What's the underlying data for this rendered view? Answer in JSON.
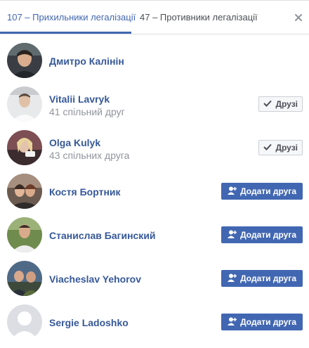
{
  "tabs": [
    {
      "label": "107 – Прихильники легалізації",
      "active": true
    },
    {
      "label": "47 – Противники легалізації",
      "active": false
    }
  ],
  "people": [
    {
      "name": "Дмитро Калінін",
      "mutual": "",
      "action": "none",
      "avatar": "photo-man-dark-hair"
    },
    {
      "name": "Vitalii Lavryk",
      "mutual": "41 спільний друг",
      "action": "friends",
      "avatar": "photo-man-white-shirt"
    },
    {
      "name": "Olga Kulyk",
      "mutual": "43 спільних друга",
      "action": "friends",
      "avatar": "photo-woman-blonde"
    },
    {
      "name": "Костя Бортник",
      "mutual": "",
      "action": "add",
      "avatar": "photo-couple"
    },
    {
      "name": "Станислав Багинский",
      "mutual": "",
      "action": "add",
      "avatar": "photo-man-outdoors"
    },
    {
      "name": "Viacheslav Yehorov",
      "mutual": "",
      "action": "add",
      "avatar": "photo-two-men"
    },
    {
      "name": "Sergie Ladoshko",
      "mutual": "",
      "action": "add",
      "avatar": "default-silhouette"
    }
  ],
  "buttons": {
    "friends_label": "Друзі",
    "add_label": "Додати друга"
  },
  "colors": {
    "accent": "#4267b2",
    "name": "#365899",
    "muted": "#90949c"
  }
}
